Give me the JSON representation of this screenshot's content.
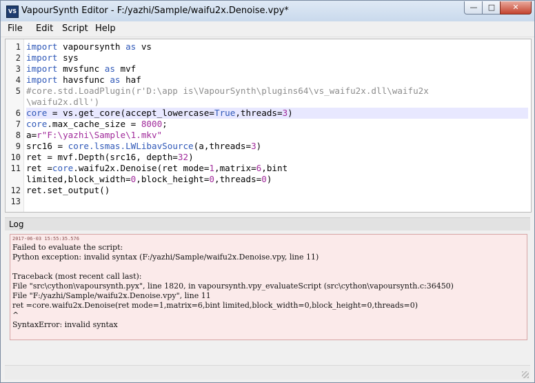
{
  "window": {
    "title": "VapourSynth Editor - F:/yazhi/Sample/waifu2x.Denoise.vpy*",
    "icon_label": "VS",
    "controls": {
      "minimize": "—",
      "maximize": "□",
      "close": "✕"
    }
  },
  "menu": [
    "File",
    "Edit",
    "Script",
    "Help"
  ],
  "editor": {
    "line_numbers": [
      "1",
      "2",
      "3",
      "4",
      "5",
      "",
      "6",
      "7",
      "8",
      "9",
      "10",
      "11",
      "",
      "12",
      "13"
    ],
    "current_line": 6
  },
  "log": {
    "title": "Log",
    "timestamp": "2017-06-03 15:55:35.576",
    "lines": [
      "Failed to evaluate the script:",
      "Python exception: invalid syntax (F:/yazhi/Sample/waifu2x.Denoise.vpy, line 11)",
      "",
      "Traceback (most recent call last):",
      "File \"src\\cython\\vapoursynth.pyx\", line 1820, in vapoursynth.vpy_evaluateScript (src\\cython\\vapoursynth.c:36450)",
      "File \"F:/yazhi/Sample/waifu2x.Denoise.vpy\", line 11",
      "ret =core.waifu2x.Denoise(ret mode=1,matrix=6,bint limited,block_width=0,block_height=0,threads=0)",
      "^",
      "SyntaxError: invalid syntax"
    ]
  },
  "colors": {
    "keyword": "#2f58b8",
    "comment": "#8c8c8c",
    "string": "#a0299a",
    "log_background": "#fbeaea"
  }
}
